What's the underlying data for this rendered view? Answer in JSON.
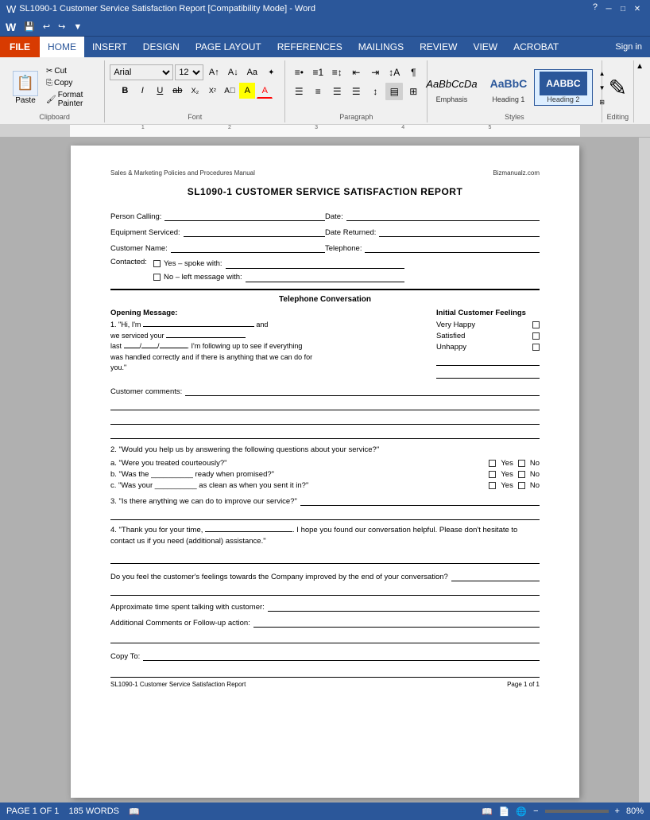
{
  "titlebar": {
    "title": "SL1090-1 Customer Service Satisfaction Report [Compatibility Mode] - Word",
    "controls": [
      "_",
      "□",
      "✕"
    ]
  },
  "quickaccess": {
    "buttons": [
      "💾",
      "↩",
      "↪",
      "▼"
    ]
  },
  "menubar": {
    "file": "FILE",
    "items": [
      "HOME",
      "INSERT",
      "DESIGN",
      "PAGE LAYOUT",
      "REFERENCES",
      "MAILINGS",
      "REVIEW",
      "VIEW",
      "ACROBAT"
    ],
    "active": "HOME",
    "signin": "Sign in"
  },
  "ribbon": {
    "groups": {
      "clipboard": {
        "label": "Clipboard",
        "paste": "Paste",
        "cut": "Cut",
        "copy": "Copy",
        "format_painter": "Format Painter"
      },
      "font": {
        "label": "Font",
        "name": "Arial",
        "size": "12",
        "bold": "B",
        "italic": "I",
        "underline": "U",
        "strikethrough": "ab",
        "subscript": "X₂",
        "superscript": "X²",
        "case": "Aa",
        "highlight": "A",
        "color": "A"
      },
      "paragraph": {
        "label": "Paragraph"
      },
      "styles": {
        "label": "Styles",
        "items": [
          {
            "name": "Emphasis",
            "preview": "AaBbCcDa",
            "class": "emphasis"
          },
          {
            "name": "Heading 1",
            "preview": "AaBbC",
            "class": "heading1"
          },
          {
            "name": "Heading 2",
            "preview": "AABBC",
            "class": "heading2"
          }
        ]
      },
      "editing": {
        "label": "Editing",
        "icon": "✏️"
      }
    }
  },
  "ruler": {
    "marks": [
      "1",
      "2",
      "3",
      "4",
      "5"
    ]
  },
  "page": {
    "header_left": "Sales & Marketing Policies and Procedures Manual",
    "header_right": "Bizmanualz.com",
    "title": "SL1090-1 CUSTOMER SERVICE SATISFACTION REPORT",
    "fields": {
      "person_calling": "Person Calling:",
      "date": "Date:",
      "equipment_serviced": "Equipment Serviced:",
      "date_returned": "Date Returned:",
      "customer_name": "Customer Name:",
      "telephone": "Telephone:",
      "contacted": "Contacted:",
      "yes_spoke": "Yes – spoke with:",
      "no_left": "No – left message with:"
    },
    "section_title": "Telephone Conversation",
    "opening_message_label": "Opening Message:",
    "opening_message": "1. \"Hi, I'm _________________________ and we serviced your _____________________ last ___/___/_______. I'm following up to see if everything was handled correctly and if there is anything that we can do for you.\"",
    "initial_feelings_label": "Initial Customer Feelings",
    "feelings": [
      "Very Happy",
      "Satisfied",
      "Unhappy"
    ],
    "customer_comments_label": "Customer comments:",
    "question2": "2. \"Would you help us by answering the following questions about your service?\"",
    "q2a": "a.  \"Were you treated courteously?\"",
    "q2b": "b.  \"Was the __________ ready when promised?\"",
    "q2c": "c.  \"Was your __________ as clean as when you sent it in?\"",
    "question3": "3. \"Is there anything we can do to improve our service?\"",
    "question4": "4. \"Thank you for your time, _____________________. I hope you found our conversation helpful. Please don't hesitate to contact us if you need (additional) assistance.\"",
    "feelings_question": "Do you feel the customer's feelings towards the Company improved by the end of your conversation?",
    "approx_time": "Approximate time spent talking with customer:",
    "additional_comments": "Additional Comments or Follow-up action:",
    "copy_to": "Copy To:",
    "footer_left": "SL1090-1 Customer Service Satisfaction Report",
    "footer_right": "Page 1 of 1",
    "yes_no": "□ Yes  □ No"
  },
  "statusbar": {
    "page": "PAGE 1 OF 1",
    "words": "185 WORDS",
    "zoom": "80%"
  }
}
